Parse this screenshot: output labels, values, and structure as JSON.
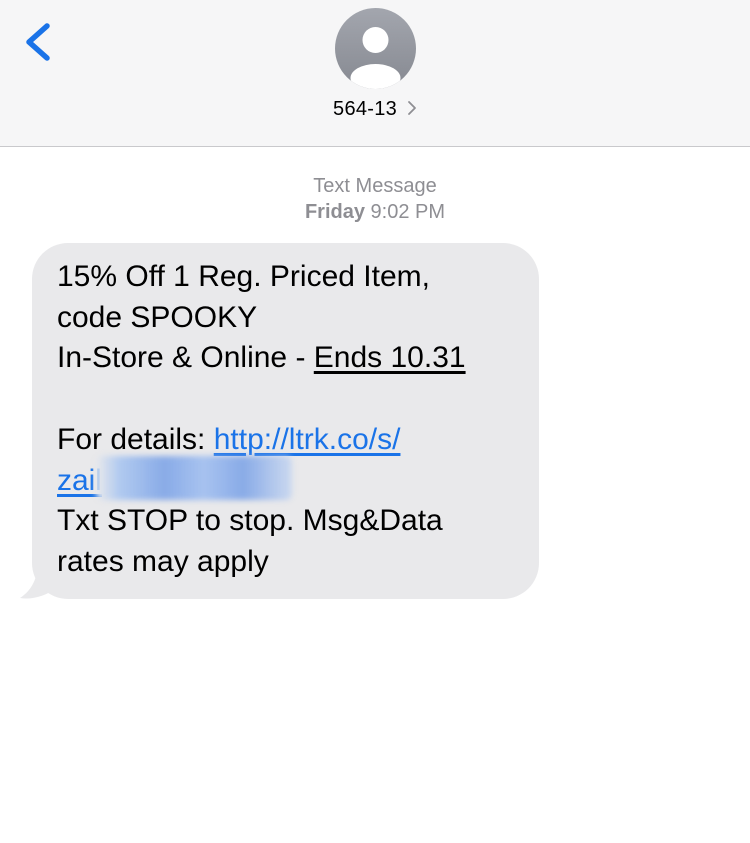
{
  "header": {
    "back_icon": "chevron-left-icon",
    "avatar_icon": "person-icon",
    "contact_name": "564-13",
    "contact_chevron_icon": "chevron-right-icon",
    "accent_color": "#1a73e8"
  },
  "conversation": {
    "service": "Text Message",
    "day": "Friday",
    "time": "9:02 PM"
  },
  "message": {
    "line1": "15% Off 1 Reg. Priced Item,",
    "line2": "code SPOOKY",
    "line3_prefix": "In-Store & Online - ",
    "line3_underlined": "Ends 10.31",
    "details_prefix": "For details: ",
    "link_line1": "http://ltrk.co/s/",
    "link_line2_visible": "zail",
    "line_stop": "Txt STOP to stop. Msg&Data",
    "line_rates": "rates may apply",
    "bubble_color": "#e9e9eb"
  }
}
